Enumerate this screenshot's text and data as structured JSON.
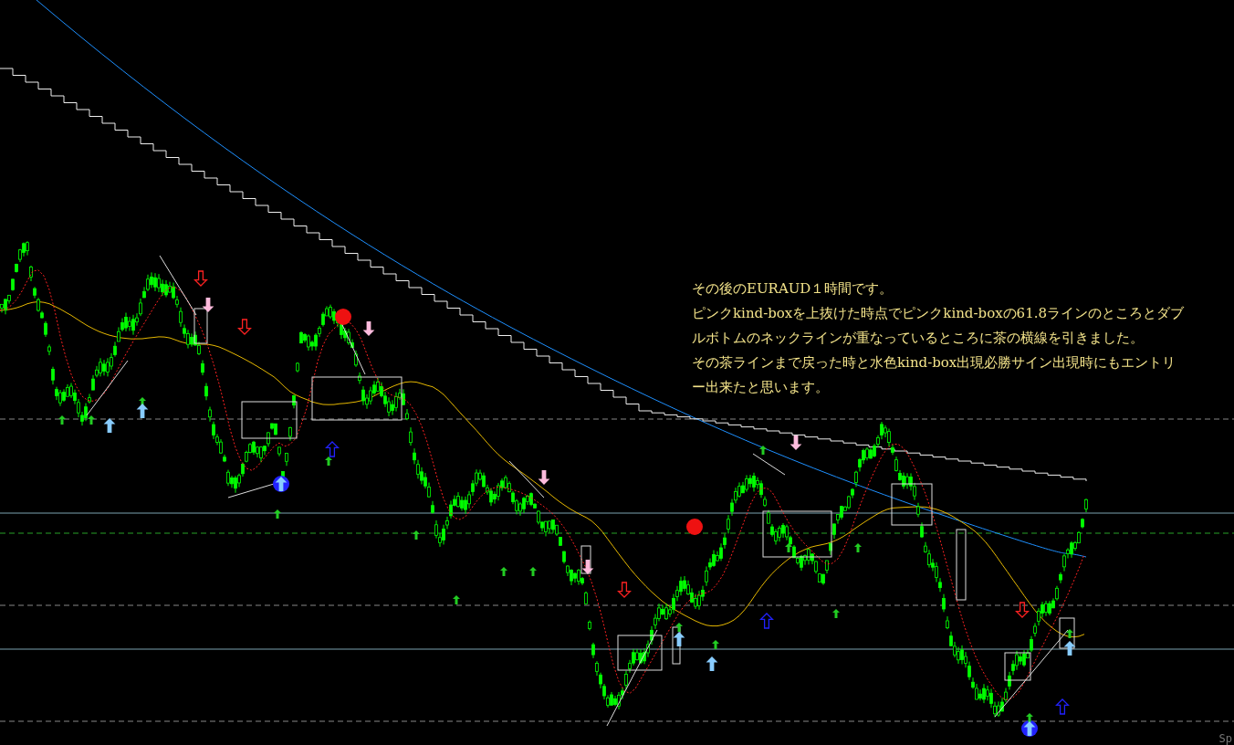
{
  "annotation": {
    "lines": [
      "その後のEURAUD１時間です。",
      "ピンクkind-boxを上抜けた時点でピンクkind-boxの61.8ラインのところとダブ",
      "ルボトムのネックラインが重なっているところに茶の横線を引きました。",
      "その茶ラインまで戻った時と水色kind-box出現必勝サイン出現時にもエントリ",
      "ー出来たと思います。"
    ]
  },
  "corner_label": "Sp"
}
